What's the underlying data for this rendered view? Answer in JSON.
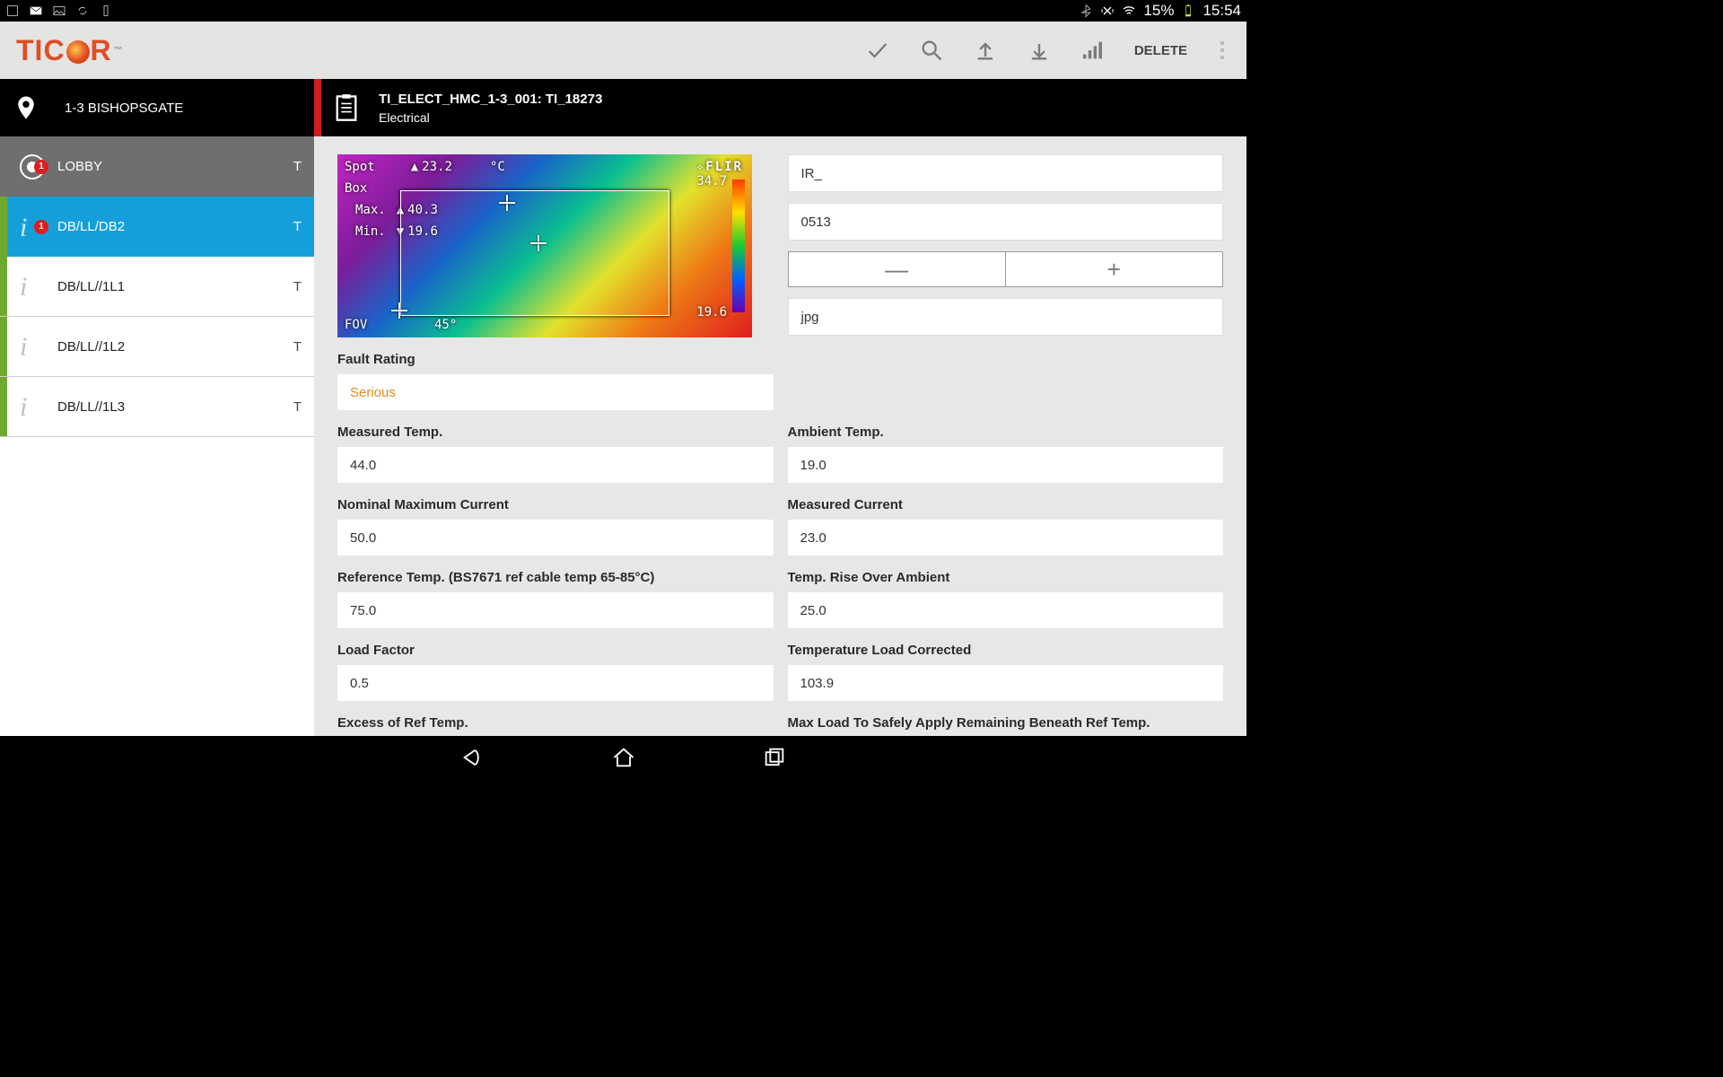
{
  "status": {
    "battery": "15%",
    "time": "15:54"
  },
  "toolbar": {
    "logo_1": "TIC",
    "logo_2": "R",
    "delete_label": "DELETE"
  },
  "location": {
    "name": "1-3 BISHOPSGATE"
  },
  "sidebar": [
    {
      "label": "LOBBY",
      "suffix": "T",
      "badge": "1",
      "style": "lobby",
      "icon": "target"
    },
    {
      "label": "DB/LL/DB2",
      "suffix": "T",
      "badge": "1",
      "style": "active",
      "icon": "i",
      "stripe": "green"
    },
    {
      "label": "DB/LL//1L1",
      "suffix": "T",
      "style": "",
      "icon": "i",
      "stripe": "green"
    },
    {
      "label": "DB/LL//1L2",
      "suffix": "T",
      "style": "",
      "icon": "i",
      "stripe": "green"
    },
    {
      "label": "DB/LL//1L3",
      "suffix": "T",
      "style": "",
      "icon": "i",
      "stripe": "green"
    }
  ],
  "header": {
    "title": "TI_ELECT_HMC_1-3_001: TI_18273",
    "subtitle": "Electrical"
  },
  "thermal": {
    "spot_label": "Spot",
    "spot_value": "23.2",
    "box_label": "Box",
    "max_label": "Max.",
    "max_value": "40.3",
    "min_label": "Min.",
    "min_value": "19.6",
    "unit": "°C",
    "brand": "✧FLIR",
    "scale_top": "34.7",
    "scale_bot": "19.6",
    "fov_label": "FOV",
    "fov_value": "45°"
  },
  "right_inputs": {
    "prefix": "IR_",
    "number": "0513",
    "ext": "jpg",
    "dec": "—",
    "inc": "+"
  },
  "form": {
    "fault_label": "Fault Rating",
    "fault_value": "Serious",
    "measured_temp_label": "Measured Temp.",
    "measured_temp_value": "44.0",
    "ambient_temp_label": "Ambient Temp.",
    "ambient_temp_value": "19.0",
    "nominal_label": "Nominal Maximum Current",
    "nominal_value": "50.0",
    "measured_current_label": "Measured Current",
    "measured_current_value": "23.0",
    "ref_temp_label": "Reference Temp. (BS7671 ref cable temp 65-85°C)",
    "ref_temp_value": "75.0",
    "rise_label": "Temp. Rise Over Ambient",
    "rise_value": "25.0",
    "load_factor_label": "Load Factor",
    "load_factor_value": "0.5",
    "temp_load_corr_label": "Temperature Load Corrected",
    "temp_load_corr_value": "103.9",
    "excess_label": "Excess of Ref Temp.",
    "maxload_label": "Max Load To Safely Apply Remaining Beneath Ref Temp."
  }
}
